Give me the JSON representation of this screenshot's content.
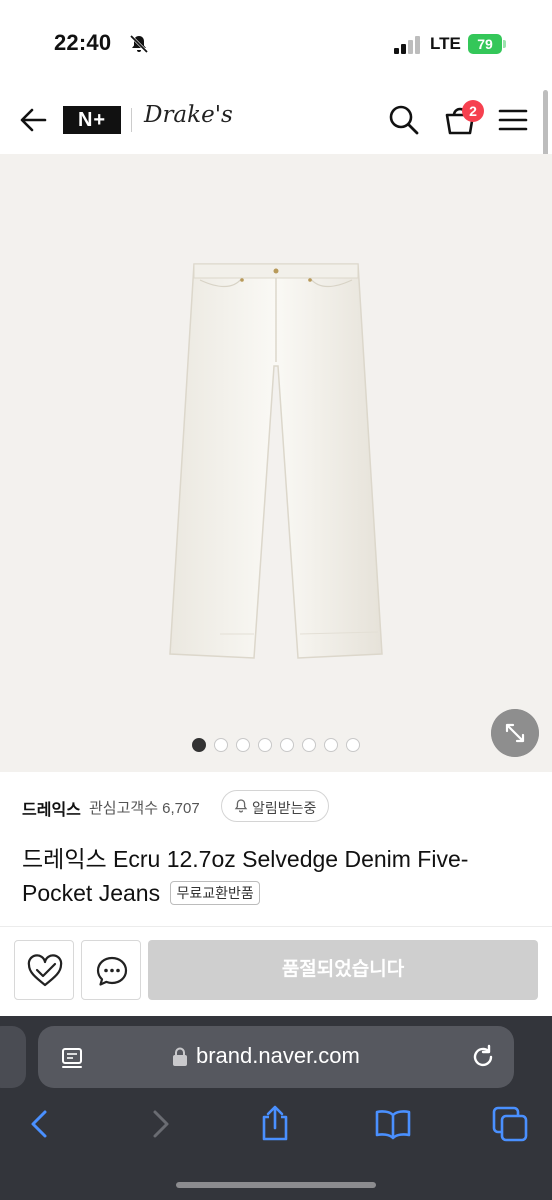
{
  "status_bar": {
    "time": "22:40",
    "network": "LTE",
    "battery": "79"
  },
  "header": {
    "logo_np": "N+",
    "brand_logo": "Drake's",
    "cart_count": "2"
  },
  "gallery": {
    "image_count": 8,
    "active_index": 0
  },
  "product": {
    "brand": "드레익스",
    "favorite_count": "관심고객수 6,707",
    "alert_label": "알림받는중",
    "title": "드레익스 Ecru 12.7oz Selvedge Denim Five-Pocket Jeans",
    "tag": "무료교환반품"
  },
  "actions": {
    "soldout_label": "품절되었습니다"
  },
  "browser": {
    "url": "brand.naver.com"
  },
  "colors": {
    "accent_badge": "#f6404f",
    "battery": "#34c759",
    "soldout_bg": "#cfcfcf",
    "safari_bg": "#33353b",
    "safari_accent": "#4a90ff"
  },
  "icons": {
    "back": "arrow-left-icon",
    "search": "search-icon",
    "cart": "shopping-bag-icon",
    "menu": "hamburger-menu-icon",
    "expand": "expand-arrows-icon",
    "wish": "heart-check-icon",
    "talk": "chat-bubble-icon",
    "lock": "lock-icon",
    "reload": "reload-icon",
    "share": "share-icon",
    "bookmarks": "book-icon",
    "tabs": "tabs-icon"
  }
}
